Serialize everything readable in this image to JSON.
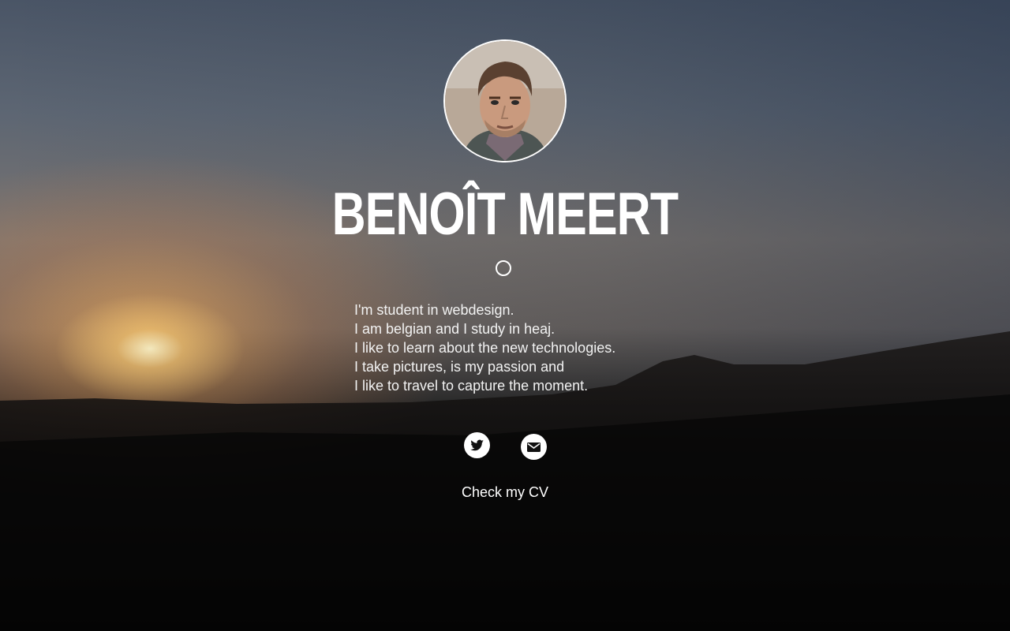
{
  "profile": {
    "name": "BENOÎT MEERT",
    "avatar_icon": "portrait-photo"
  },
  "bio": {
    "lines": [
      "I'm student in webdesign.",
      "I am belgian and I study in heaj.",
      "I like to learn about the new technologies.",
      "I take pictures, is my passion and",
      "I like to travel to capture the moment."
    ]
  },
  "social": {
    "twitter_icon": "twitter-icon",
    "mail_icon": "mail-icon"
  },
  "cv_link": {
    "label": "Check my CV"
  },
  "colors": {
    "text": "#ffffff",
    "sky_top": "#4a5566",
    "sun_glow": "#f0aa5a",
    "ground": "#050505"
  }
}
